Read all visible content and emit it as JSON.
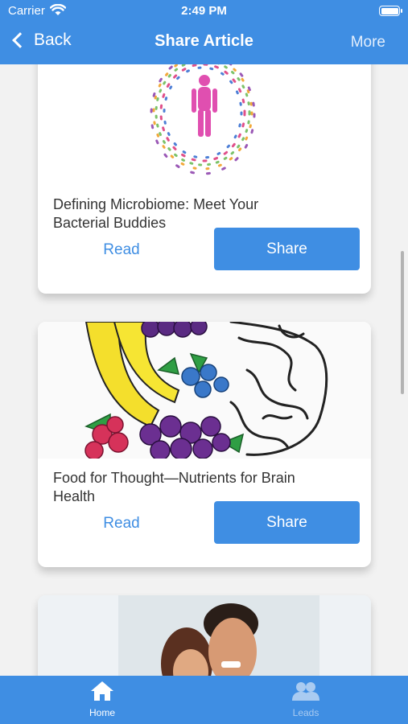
{
  "status_bar": {
    "carrier": "Carrier",
    "time": "2:49 PM"
  },
  "nav": {
    "back_label": "Back",
    "title": "Share Article",
    "more_label": "More"
  },
  "articles": [
    {
      "title": "Defining Microbiome: Meet Your Bacterial Buddies",
      "read_label": "Read",
      "share_label": "Share"
    },
    {
      "title": "Food for Thought—Nutrients for Brain Health",
      "read_label": "Read",
      "share_label": "Share"
    }
  ],
  "tabs": [
    {
      "label": "Home",
      "icon": "home-icon",
      "active": true
    },
    {
      "label": "Leads",
      "icon": "people-icon",
      "active": false
    }
  ],
  "colors": {
    "accent": "#3f8ee3",
    "inactive_tab": "#a9cbf1"
  }
}
